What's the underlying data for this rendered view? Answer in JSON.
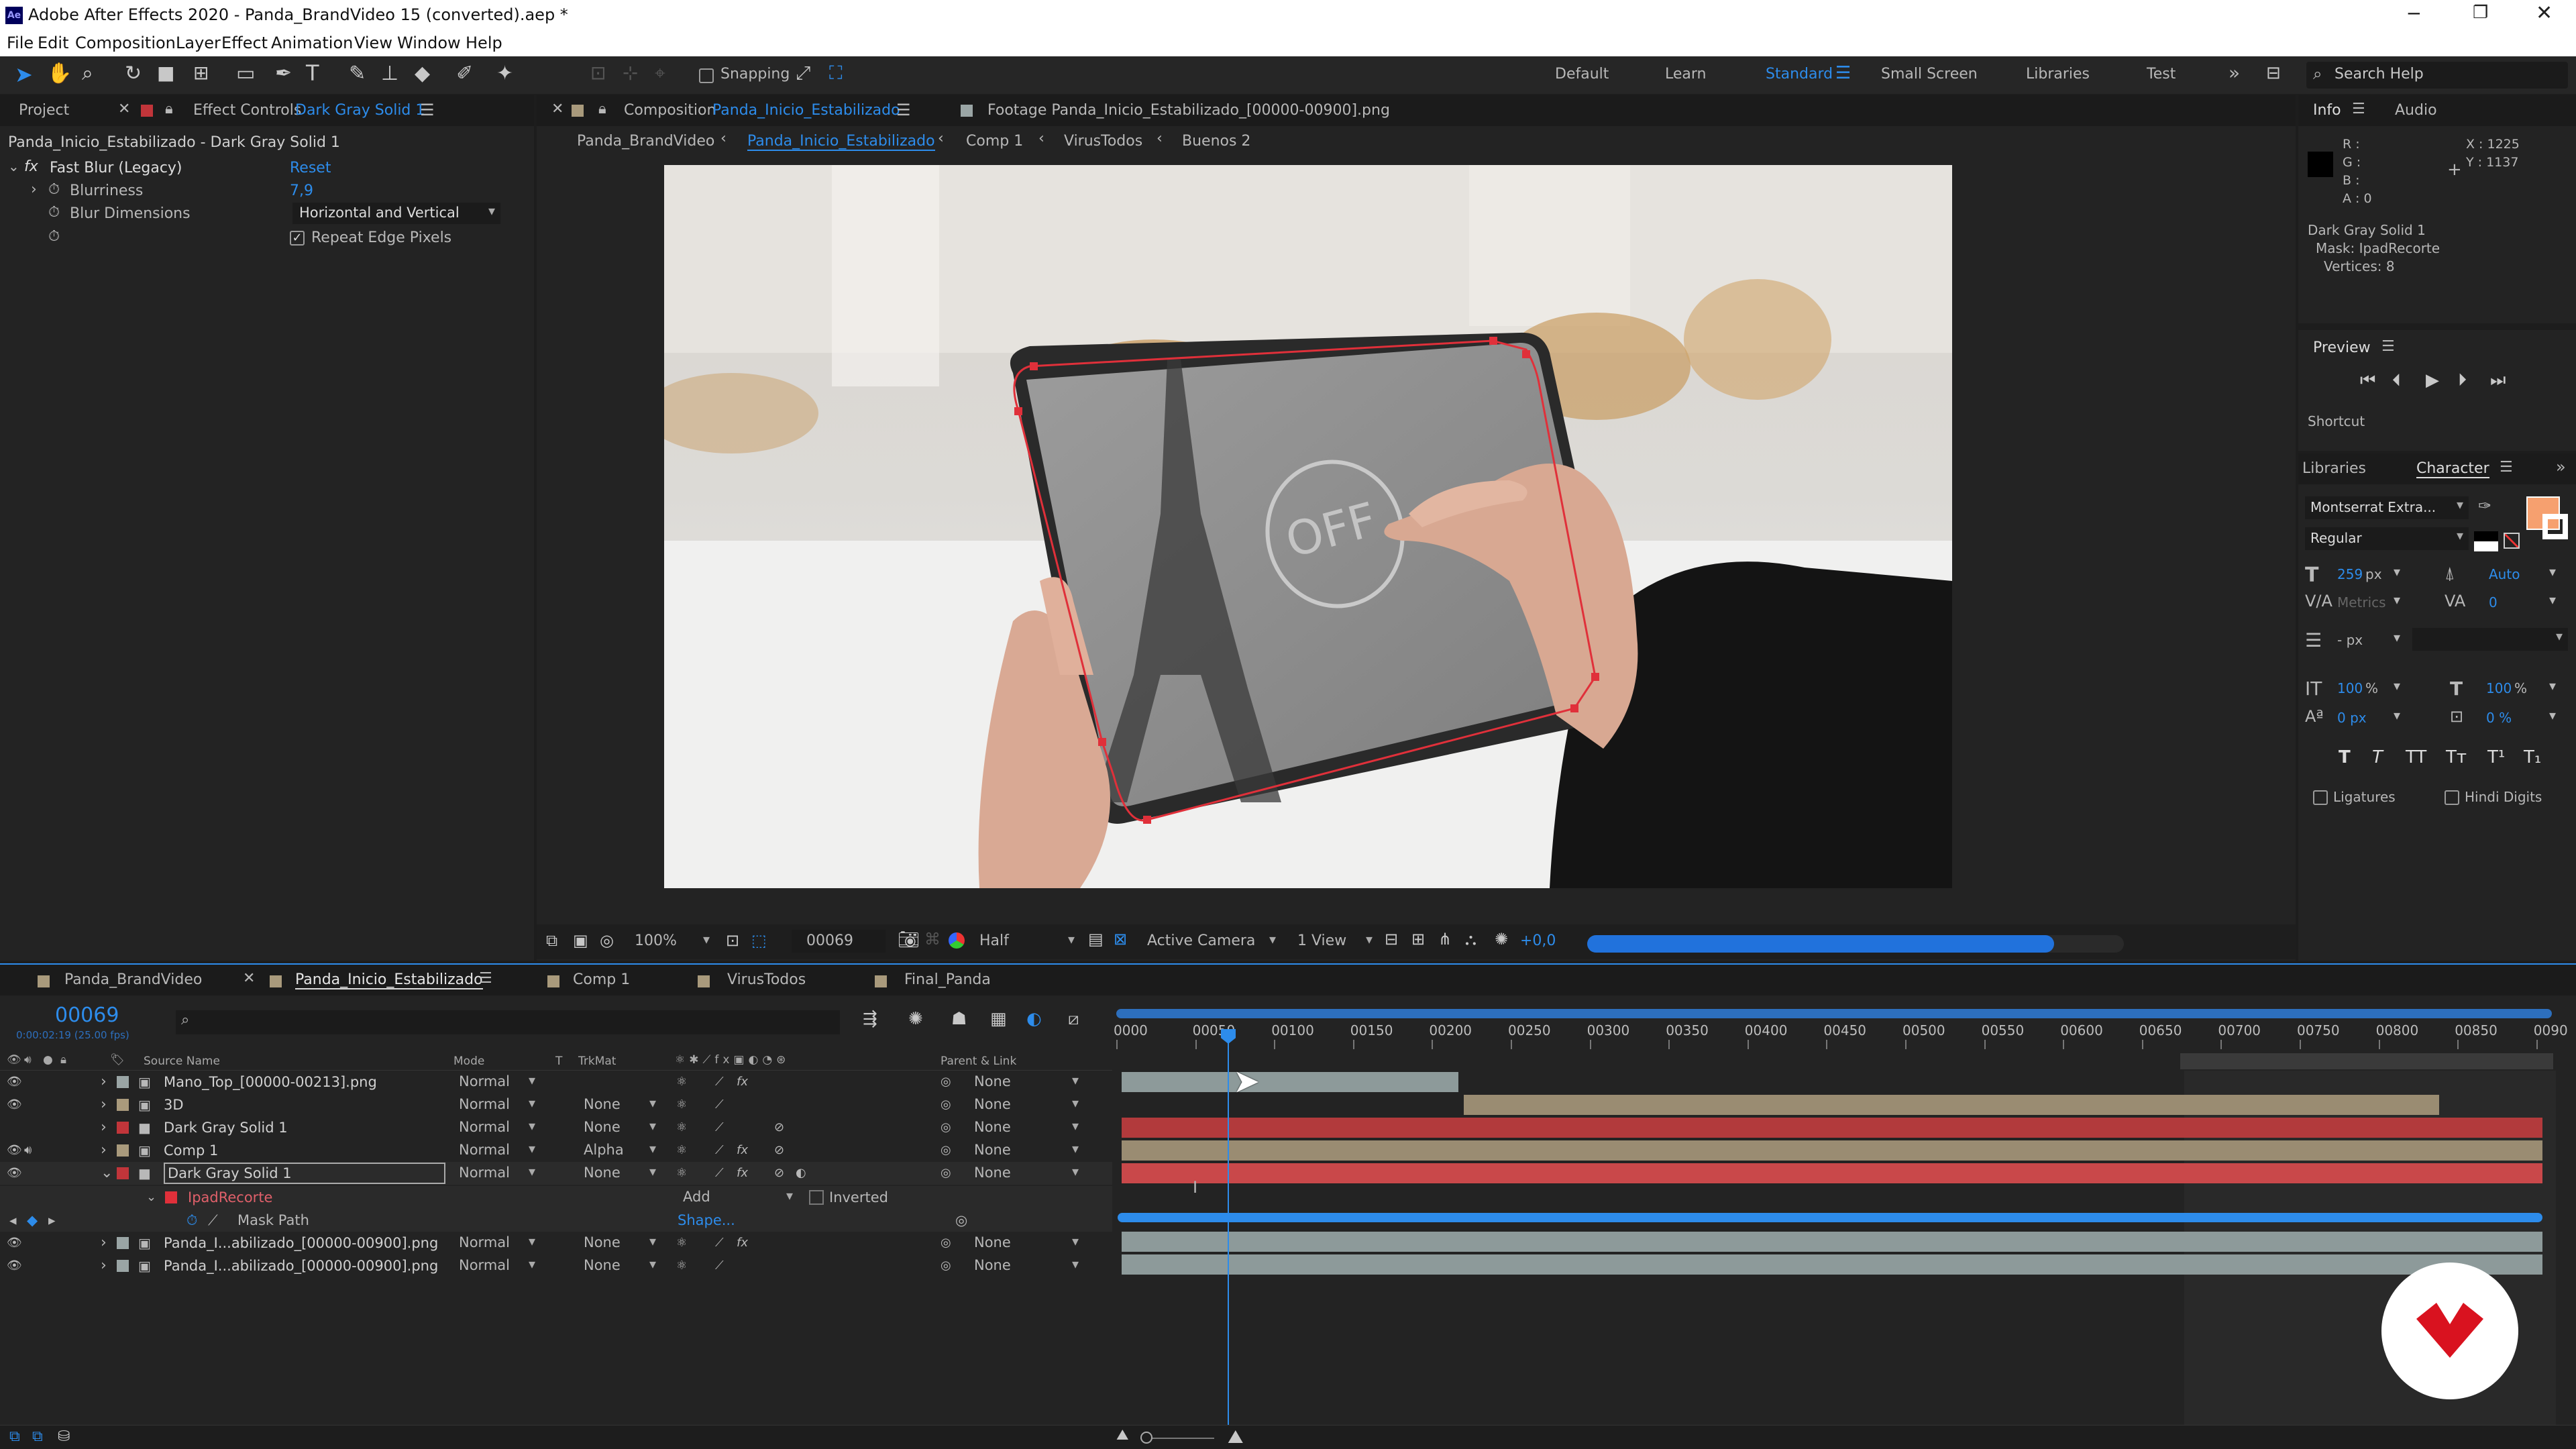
{
  "window": {
    "title": "Adobe After Effects 2020 - Panda_BrandVideo 15 (converted).aep *",
    "app_icon": "Ae"
  },
  "menu": [
    "File",
    "Edit",
    "Composition",
    "Layer",
    "Effect",
    "Animation",
    "View",
    "Window",
    "Help"
  ],
  "toolbar": {
    "snapping_label": "Snapping",
    "workspaces": [
      "Default",
      "Learn",
      "Standard",
      "Small Screen",
      "Libraries",
      "Test"
    ],
    "active_workspace": "Standard",
    "search_placeholder": "Search Help"
  },
  "left_panel": {
    "tab_project": "Project",
    "tab_effect_controls": "Effect Controls",
    "effect_layer": "Dark Gray Solid 1",
    "path": "Panda_Inicio_Estabilizado - Dark Gray Solid 1",
    "effect_name": "Fast Blur (Legacy)",
    "reset_label": "Reset",
    "props": [
      {
        "label": "Blurriness",
        "value": "7,9"
      },
      {
        "label": "Blur Dimensions",
        "value": "Horizontal and Vertical"
      }
    ],
    "repeat_edge_label": "Repeat Edge Pixels"
  },
  "viewer": {
    "comp_tab_prefix": "Composition",
    "comp_tab_name": "Panda_Inicio_Estabilizado",
    "footage_tab": "Footage  Panda_Inicio_Estabilizado_[00000-00900].png",
    "breadcrumbs": [
      "Panda_BrandVideo",
      "Panda_Inicio_Estabilizado",
      "Comp 1",
      "VirusTodos",
      "Buenos 2"
    ],
    "active_breadcrumb": "Panda_Inicio_Estabilizado",
    "screen_text": "OFF",
    "zoom": "100%",
    "timecode": "00069",
    "resolution": "Half",
    "camera": "Active Camera",
    "views": "1 View",
    "exposure": "+0,0",
    "render_progress": 0.87
  },
  "info_panel": {
    "tab_info": "Info",
    "tab_audio": "Audio",
    "rgba": [
      "R :",
      "G :",
      "B :",
      "A : 0"
    ],
    "x": "X : 1225",
    "y": "Y : 1137",
    "layer": "Dark Gray Solid 1",
    "mask": "Mask: IpadRecorte",
    "vertices": "Vertices: 8"
  },
  "preview_panel": {
    "title": "Preview",
    "shortcut": "Shortcut"
  },
  "character_panel": {
    "tab_libraries": "Libraries",
    "tab_character": "Character",
    "font": "Montserrat Extra...",
    "style": "Regular",
    "size": "259",
    "size_unit": "px",
    "leading": "Auto",
    "kerning": "Metrics",
    "tracking": "0",
    "stroke_unit": "- px",
    "vscale": "100",
    "hscale": "100",
    "percent": "%",
    "baseline": "0 px",
    "tsume": "0 %",
    "type_styles": [
      "T",
      "T",
      "TT",
      "Tт",
      "T¹",
      "T₁"
    ],
    "ligatures": "Ligatures",
    "hindi_digits": "Hindi Digits",
    "fill_color": "#f6a06f"
  },
  "timeline": {
    "tabs": [
      "Panda_BrandVideo",
      "Panda_Inicio_Estabilizado",
      "Comp 1",
      "VirusTodos",
      "Final_Panda"
    ],
    "active_tab": "Panda_Inicio_Estabilizado",
    "current_frame": "00069",
    "current_time": "0:00:02:19 (25.00 fps)",
    "columns": {
      "source_name": "Source Name",
      "mode": "Mode",
      "t": "T",
      "trkmat": "TrkMat",
      "parent": "Parent & Link"
    },
    "ruler": [
      "0000",
      "00050",
      "00100",
      "00150",
      "00200",
      "00250",
      "00300",
      "00350",
      "00400",
      "00450",
      "00500",
      "00550",
      "00600",
      "00650",
      "00700",
      "00750",
      "00800",
      "00850",
      "0090"
    ],
    "layers": [
      {
        "name": "Mano_Top_[00000-00213].png",
        "mode": "Normal",
        "trkmat": "",
        "parent": "None",
        "label_color": "#9aa5a5"
      },
      {
        "name": "3D",
        "mode": "Normal",
        "trkmat": "None",
        "parent": "None",
        "label_color": "#a99a7c"
      },
      {
        "name": "Dark Gray Solid 1",
        "mode": "Normal",
        "trkmat": "None",
        "parent": "None",
        "label_color": "#c1353a"
      },
      {
        "name": "Comp 1",
        "mode": "Normal",
        "trkmat": "Alpha",
        "parent": "None",
        "label_color": "#a99a7c"
      },
      {
        "name": "Dark Gray Solid 1",
        "mode": "Normal",
        "trkmat": "None",
        "parent": "None",
        "label_color": "#c1353a"
      },
      {
        "name": "Panda_I...abilizado_[00000-00900].png",
        "mode": "Normal",
        "trkmat": "None",
        "parent": "None",
        "label_color": "#9aa5a5"
      },
      {
        "name": "Panda_I...abilizado_[00000-00900].png",
        "mode": "Normal",
        "trkmat": "None",
        "parent": "None",
        "label_color": "#9aa5a5"
      }
    ],
    "mask": {
      "name": "IpadRecorte",
      "mode": "Add",
      "inverted_label": "Inverted",
      "path_label": "Mask Path",
      "shape_label": "Shape..."
    }
  },
  "colors": {
    "accent": "#2d8ceb",
    "solid_red": "#c1353a"
  }
}
